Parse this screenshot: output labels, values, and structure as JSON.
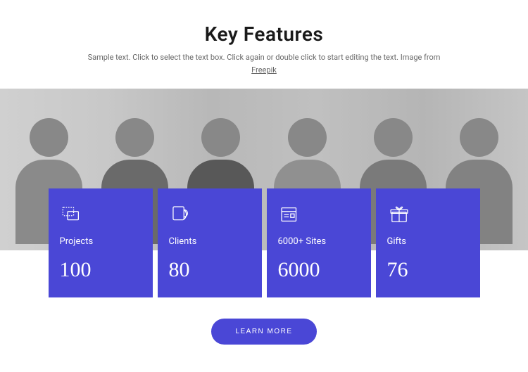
{
  "header": {
    "title": "Key Features",
    "subtitle_pre": "Sample text. Click to select the text box. Click again or double click to start editing the text. Image from ",
    "subtitle_link": "Freepik"
  },
  "cards": [
    {
      "icon": "cards-icon",
      "label": "Projects",
      "value": "100"
    },
    {
      "icon": "shell-icon",
      "label": "Clients",
      "value": "80"
    },
    {
      "icon": "newspaper-icon",
      "label": "6000+ Sites",
      "value": "6000"
    },
    {
      "icon": "gift-icon",
      "label": "Gifts",
      "value": "76"
    }
  ],
  "cta": {
    "label": "LEARN MORE"
  },
  "colors": {
    "accent": "#4a47d6"
  }
}
